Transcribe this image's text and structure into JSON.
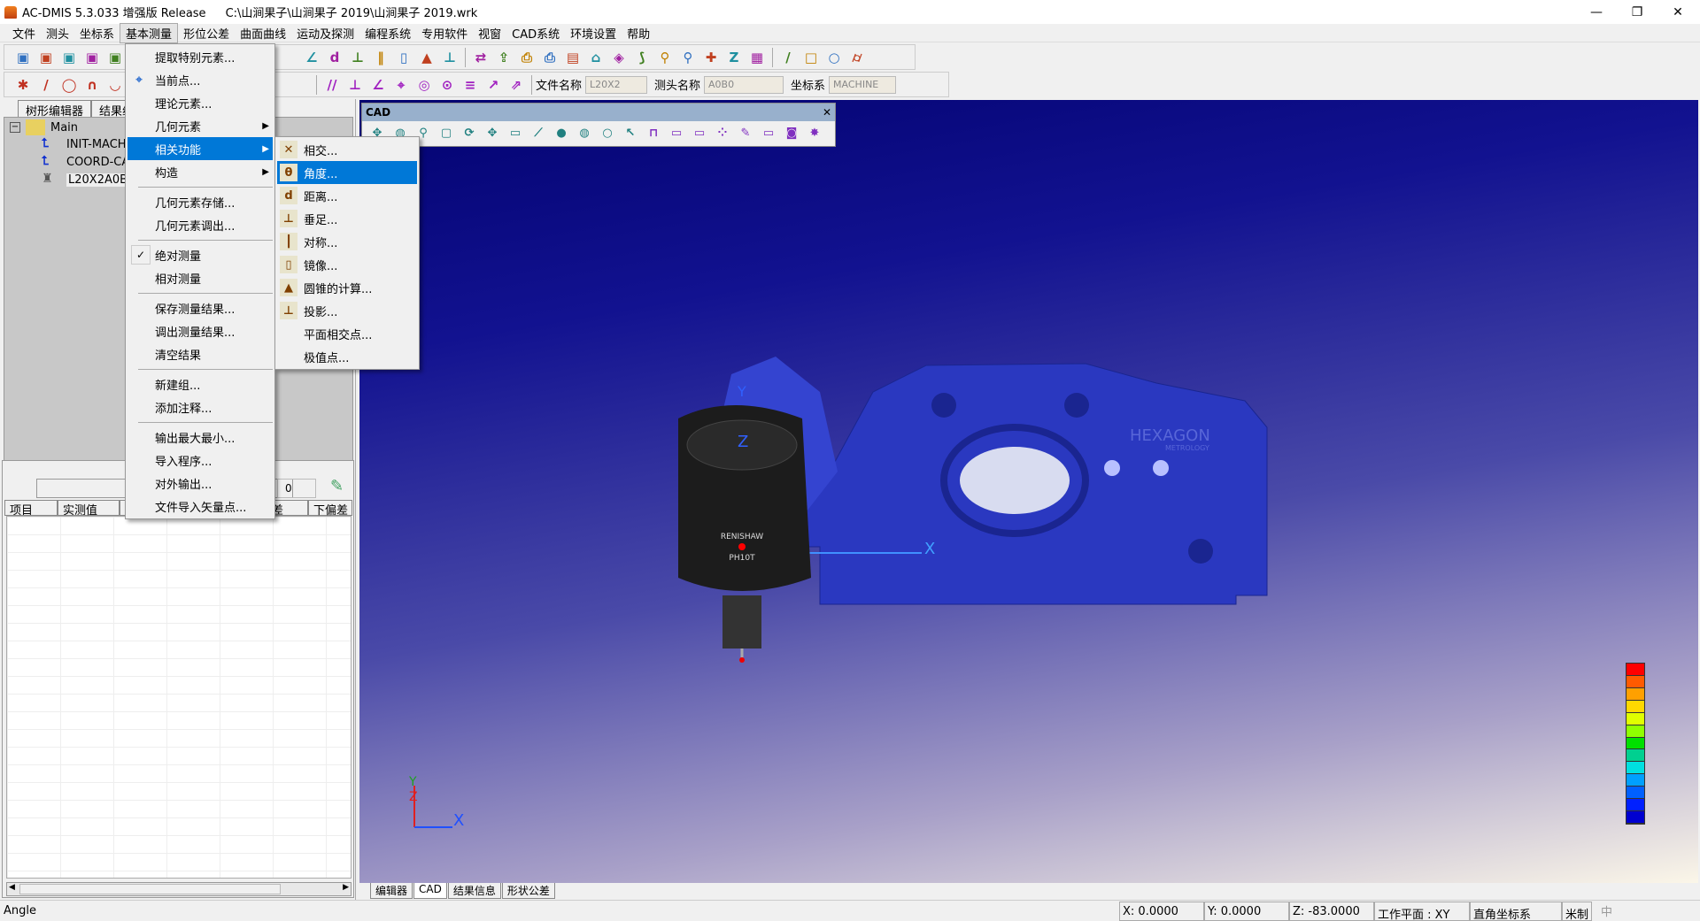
{
  "window": {
    "app_title": "AC-DMIS 5.3.033 增强版 Release",
    "file_path": "C:\\山涧果子\\山涧果子 2019\\山涧果子 2019.wrk",
    "minimize": "—",
    "restore": "❐",
    "close": "✕"
  },
  "menubar": [
    "文件",
    "测头",
    "坐标系",
    "基本测量",
    "形位公差",
    "曲面曲线",
    "运动及探测",
    "编程系统",
    "专用软件",
    "视窗",
    "CAD系统",
    "环境设置",
    "帮助"
  ],
  "menubar_active": "基本测量",
  "toolbar2": {
    "file_label": "文件名称",
    "file_value": "L20X2",
    "probe_label": "测头名称",
    "probe_value": "A0B0",
    "coord_label": "坐标系",
    "coord_value": "MACHINE"
  },
  "toolbar1_icons": [
    "open-program-icon",
    "save-as-icon",
    "new-file-icon",
    "open-folder-icon",
    "save-icon"
  ],
  "toolbar1b_icons": [
    "angle-icon",
    "distance-icon",
    "perpendicular-foot-icon",
    "symmetry-icon",
    "mirror-icon",
    "cone-icon",
    "projection-icon",
    "transfer-icon",
    "load-icon",
    "print-preview-icon",
    "print-icon",
    "report-icon",
    "home-icon",
    "layers-icon",
    "path-icon",
    "probe-icon",
    "joystick-icon",
    "probe-point-icon",
    "axis-icon",
    "sub-icon",
    "line-icon",
    "rectangle-icon",
    "circle-icon",
    "flatness-icon"
  ],
  "toolbar2_icons": [
    "point-icon",
    "line-measure-icon",
    "circle-measure-icon",
    "arc-icon",
    "ellipse-icon",
    "parallelism-icon",
    "perpendicularity-icon",
    "angularity-icon",
    "position-icon",
    "concentricity-icon",
    "coaxiality-icon",
    "symmetry-tol-icon",
    "runout-icon",
    "total-runout-icon"
  ],
  "left_panel": {
    "tabs": [
      "树形编辑器",
      "结果组"
    ],
    "tree": {
      "root": "Main",
      "children": [
        "INIT-MACH",
        "COORD-CAI",
        "L20X2A0B0"
      ]
    },
    "counter_value": "0",
    "table_headers": [
      "项目",
      "实测值",
      "",
      "",
      "上偏差",
      "下偏差"
    ]
  },
  "main_menu": {
    "items": [
      {
        "label": "提取特别元素..."
      },
      {
        "label": "当前点..."
      },
      {
        "label": "理论元素..."
      },
      {
        "label": "几何元素",
        "submenu": true
      },
      {
        "label": "相关功能",
        "submenu": true,
        "highlighted": true
      },
      {
        "label": "构造",
        "submenu": true
      },
      {
        "sep": true
      },
      {
        "label": "几何元素存储..."
      },
      {
        "label": "几何元素调出..."
      },
      {
        "sep": true
      },
      {
        "label": "绝对测量",
        "checked": true
      },
      {
        "label": "相对测量"
      },
      {
        "sep": true
      },
      {
        "label": "保存测量结果..."
      },
      {
        "label": "调出测量结果..."
      },
      {
        "label": "清空结果"
      },
      {
        "sep": true
      },
      {
        "label": "新建组..."
      },
      {
        "label": "添加注释..."
      },
      {
        "sep": true
      },
      {
        "label": "输出最大最小..."
      },
      {
        "label": "导入程序..."
      },
      {
        "label": "对外输出..."
      },
      {
        "label": "文件导入矢量点..."
      }
    ]
  },
  "submenu": {
    "items": [
      {
        "label": "相交...",
        "icon": "intersection-icon",
        "glyph": "✕"
      },
      {
        "label": "角度...",
        "icon": "angle-icon",
        "glyph": "θ",
        "highlighted": true
      },
      {
        "label": "距离...",
        "icon": "distance-icon",
        "glyph": "d"
      },
      {
        "label": "垂足...",
        "icon": "perpendicular-foot-icon",
        "glyph": "⊥"
      },
      {
        "label": "对称...",
        "icon": "symmetry-icon",
        "glyph": "┃"
      },
      {
        "label": "镜像...",
        "icon": "mirror-icon",
        "glyph": "▯"
      },
      {
        "label": "圆锥的计算...",
        "icon": "cone-icon",
        "glyph": "▲"
      },
      {
        "label": "投影...",
        "icon": "projection-icon",
        "glyph": "⊥"
      },
      {
        "label": "平面相交点..."
      },
      {
        "label": "极值点..."
      }
    ]
  },
  "cad_toolbar": {
    "title": "CAD",
    "close": "✕",
    "icons": [
      "move-icon",
      "zoom-icon",
      "zoom-window-icon",
      "view-cube-icon",
      "rotate-icon",
      "pan-zoom-icon",
      "select-window-icon",
      "select-plane-icon",
      "shaded-icon",
      "wireframe-icon",
      "circle-outline-icon",
      "pointer-icon",
      "fixture-icon",
      "label-select-icon",
      "multi-label-icon",
      "points-icon",
      "brush-icon",
      "window-icon",
      "camera-icon",
      "refresh-icon"
    ]
  },
  "viewport": {
    "brand": "HEXAGON",
    "brand_sub": "METROLOGY",
    "probe_brand": "RENISHAW",
    "probe_model": "PH10T",
    "axis_x": "X",
    "axis_y": "Y",
    "axis_z": "Z",
    "color_scale": [
      "#ff0000",
      "#ff5a00",
      "#ffa000",
      "#ffd800",
      "#e0ff00",
      "#90ff00",
      "#00e000",
      "#00d090",
      "#00e0e0",
      "#00a0ff",
      "#0060ff",
      "#0020ff",
      "#0000d0"
    ]
  },
  "bottom_tabs": [
    {
      "label": "编辑器"
    },
    {
      "label": "CAD",
      "active": true
    },
    {
      "label": "结果信息"
    },
    {
      "label": "形状公差"
    }
  ],
  "statusbar": {
    "message": "Angle",
    "x": "X: 0.0000",
    "y": "Y: 0.0000",
    "z": "Z: -83.0000",
    "workplane": "工作平面 : XY",
    "coord_type": "直角坐标系",
    "unit": "米制",
    "ime": "中"
  }
}
